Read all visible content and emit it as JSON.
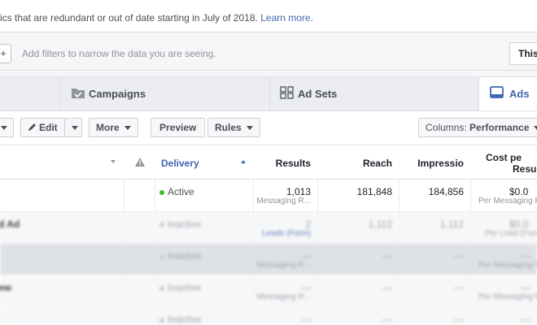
{
  "notice": {
    "text": "ics that are redundant or out of date starting in July of 2018.",
    "link": "Learn more."
  },
  "filters": {
    "add_button": "+",
    "placeholder": "Add filters to narrow the data you are seeing.",
    "right_button": "This"
  },
  "tabs": [
    {
      "label": "Campaigns",
      "icon": "folder-check-icon"
    },
    {
      "label": "Ad Sets",
      "icon": "grid-icon"
    },
    {
      "label": "Ads",
      "icon": "ad-card-icon"
    }
  ],
  "toolbar": {
    "edit": "Edit",
    "more": "More",
    "preview": "Preview",
    "rules": "Rules",
    "columns_prefix": "Columns:",
    "columns_value": "Performance"
  },
  "table": {
    "headers": {
      "delivery": "Delivery",
      "results": "Results",
      "reach": "Reach",
      "impressions": "Impressio",
      "cost_line1": "Cost pe",
      "cost_line2": "Resu"
    },
    "rows": [
      {
        "name": "",
        "delivery": "Active",
        "results": "1,013",
        "results_sub": "Messaging R...",
        "reach": "181,848",
        "impressions": "184,856",
        "cost": "$0.0",
        "cost_sub": "Per Messaging R"
      },
      {
        "name": "d Ad",
        "delivery": "Inactive",
        "results": "2",
        "results_sub": "Leads (Form)",
        "reach": "1,112",
        "impressions": "1,112",
        "cost": "$0.0",
        "cost_sub": "Per Lead (Form)"
      },
      {
        "name": "",
        "delivery": "Inactive",
        "results": "—",
        "results_sub": "Messaging R...",
        "reach": "—",
        "impressions": "—",
        "cost": "—",
        "cost_sub": "Per Messaging R"
      },
      {
        "name": "ew",
        "delivery": "Inactive",
        "results": "—",
        "results_sub": "Messaging R...",
        "reach": "—",
        "impressions": "—",
        "cost": "—",
        "cost_sub": "Per Messaging R"
      },
      {
        "name": "",
        "delivery": "Inactive",
        "results": "—",
        "results_sub": "",
        "reach": "—",
        "impressions": "—",
        "cost": "—",
        "cost_sub": ""
      }
    ]
  },
  "colors": {
    "accent": "#4267b2",
    "active_dot": "#42b72a",
    "link": "#4267b2"
  }
}
